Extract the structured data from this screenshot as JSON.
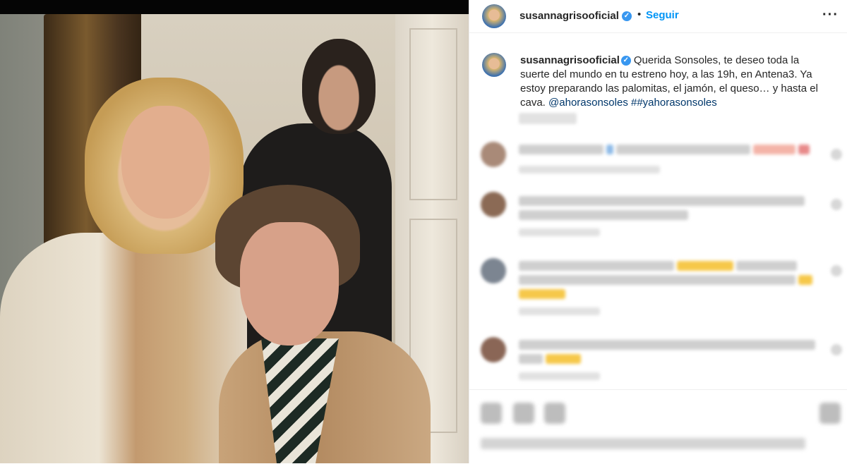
{
  "header": {
    "username": "susannagrisooficial",
    "verified_symbol": "✓",
    "separator": "•",
    "follow_label": "Seguir",
    "more_label": "···"
  },
  "caption": {
    "username": "susannagrisooficial",
    "verified_symbol": "✓",
    "text": "Querida Sonsoles, te deseo toda la suerte del mundo en tu estreno hoy, a las 19h, en Antena3. Ya estoy preparando las palomitas, el jamón, el queso… y hasta el cava.",
    "mention": "@ahorasonsoles",
    "hashtag": "##yahorasonsoles"
  },
  "icons": {
    "verified": "verified-badge-icon",
    "more": "more-options-icon",
    "like": "heart-icon",
    "comment": "comment-icon",
    "share": "share-icon",
    "save": "bookmark-icon"
  },
  "colors": {
    "link": "#0095f6",
    "mention": "#00376b",
    "verified": "#3897f0",
    "text": "#262626"
  }
}
